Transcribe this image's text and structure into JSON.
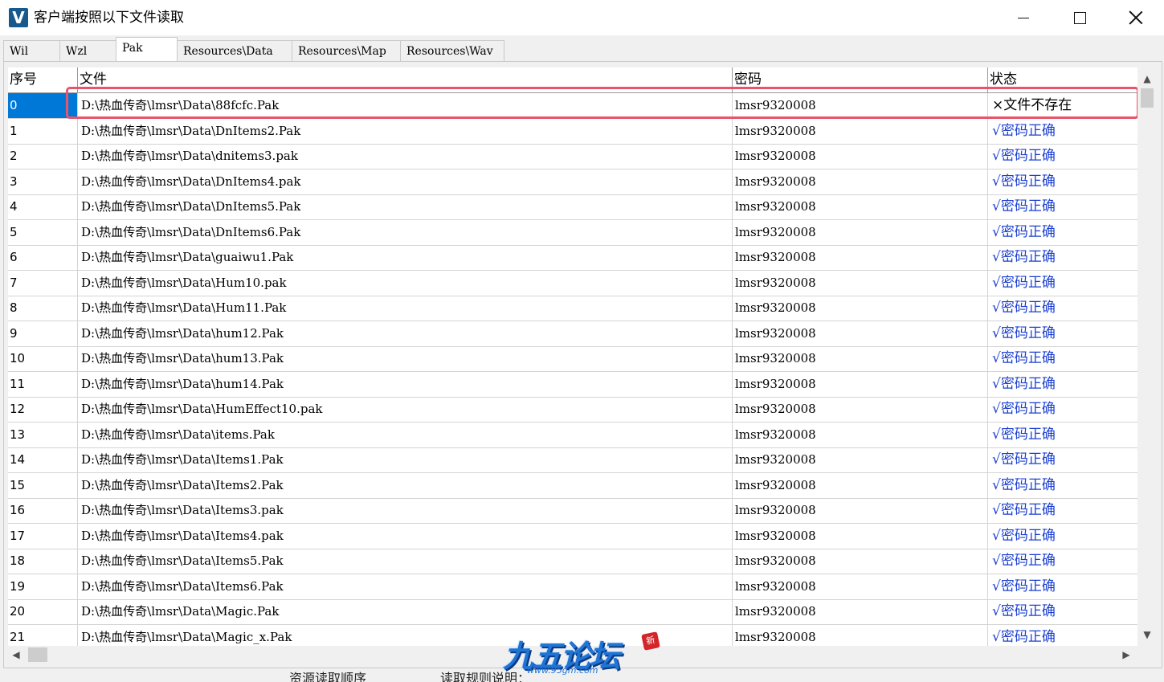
{
  "window": {
    "title": "客户端按照以下文件读取",
    "icon_letter": "V"
  },
  "tabs": [
    {
      "label": "Wil",
      "active": false
    },
    {
      "label": "Wzl",
      "active": false
    },
    {
      "label": "Pak",
      "active": true
    },
    {
      "label": "Resources\\Data",
      "active": false
    },
    {
      "label": "Resources\\Map",
      "active": false
    },
    {
      "label": "Resources\\Wav",
      "active": false
    }
  ],
  "table": {
    "columns": [
      "序号",
      "文件",
      "密码",
      "状态"
    ],
    "rows": [
      {
        "idx": "0",
        "file": "D:\\热血传奇\\lmsr\\Data\\88fcfc.Pak",
        "password": "lmsr9320008",
        "status": "×文件不存在",
        "ok": false
      },
      {
        "idx": "1",
        "file": "D:\\热血传奇\\lmsr\\Data\\DnItems2.Pak",
        "password": "lmsr9320008",
        "status": "√密码正确",
        "ok": true
      },
      {
        "idx": "2",
        "file": "D:\\热血传奇\\lmsr\\Data\\dnitems3.pak",
        "password": "lmsr9320008",
        "status": "√密码正确",
        "ok": true
      },
      {
        "idx": "3",
        "file": "D:\\热血传奇\\lmsr\\Data\\DnItems4.pak",
        "password": "lmsr9320008",
        "status": "√密码正确",
        "ok": true
      },
      {
        "idx": "4",
        "file": "D:\\热血传奇\\lmsr\\Data\\DnItems5.Pak",
        "password": "lmsr9320008",
        "status": "√密码正确",
        "ok": true
      },
      {
        "idx": "5",
        "file": "D:\\热血传奇\\lmsr\\Data\\DnItems6.Pak",
        "password": "lmsr9320008",
        "status": "√密码正确",
        "ok": true
      },
      {
        "idx": "6",
        "file": "D:\\热血传奇\\lmsr\\Data\\guaiwu1.Pak",
        "password": "lmsr9320008",
        "status": "√密码正确",
        "ok": true
      },
      {
        "idx": "7",
        "file": "D:\\热血传奇\\lmsr\\Data\\Hum10.pak",
        "password": "lmsr9320008",
        "status": "√密码正确",
        "ok": true
      },
      {
        "idx": "8",
        "file": "D:\\热血传奇\\lmsr\\Data\\Hum11.Pak",
        "password": "lmsr9320008",
        "status": "√密码正确",
        "ok": true
      },
      {
        "idx": "9",
        "file": "D:\\热血传奇\\lmsr\\Data\\hum12.Pak",
        "password": "lmsr9320008",
        "status": "√密码正确",
        "ok": true
      },
      {
        "idx": "10",
        "file": "D:\\热血传奇\\lmsr\\Data\\hum13.Pak",
        "password": "lmsr9320008",
        "status": "√密码正确",
        "ok": true
      },
      {
        "idx": "11",
        "file": "D:\\热血传奇\\lmsr\\Data\\hum14.Pak",
        "password": "lmsr9320008",
        "status": "√密码正确",
        "ok": true
      },
      {
        "idx": "12",
        "file": "D:\\热血传奇\\lmsr\\Data\\HumEffect10.pak",
        "password": "lmsr9320008",
        "status": "√密码正确",
        "ok": true
      },
      {
        "idx": "13",
        "file": "D:\\热血传奇\\lmsr\\Data\\items.Pak",
        "password": "lmsr9320008",
        "status": "√密码正确",
        "ok": true
      },
      {
        "idx": "14",
        "file": "D:\\热血传奇\\lmsr\\Data\\Items1.Pak",
        "password": "lmsr9320008",
        "status": "√密码正确",
        "ok": true
      },
      {
        "idx": "15",
        "file": "D:\\热血传奇\\lmsr\\Data\\Items2.Pak",
        "password": "lmsr9320008",
        "status": "√密码正确",
        "ok": true
      },
      {
        "idx": "16",
        "file": "D:\\热血传奇\\lmsr\\Data\\Items3.pak",
        "password": "lmsr9320008",
        "status": "√密码正确",
        "ok": true
      },
      {
        "idx": "17",
        "file": "D:\\热血传奇\\lmsr\\Data\\Items4.pak",
        "password": "lmsr9320008",
        "status": "√密码正确",
        "ok": true
      },
      {
        "idx": "18",
        "file": "D:\\热血传奇\\lmsr\\Data\\Items5.Pak",
        "password": "lmsr9320008",
        "status": "√密码正确",
        "ok": true
      },
      {
        "idx": "19",
        "file": "D:\\热血传奇\\lmsr\\Data\\Items6.Pak",
        "password": "lmsr9320008",
        "status": "√密码正确",
        "ok": true
      },
      {
        "idx": "20",
        "file": "D:\\热血传奇\\lmsr\\Data\\Magic.Pak",
        "password": "lmsr9320008",
        "status": "√密码正确",
        "ok": true
      },
      {
        "idx": "21",
        "file": "D:\\热血传奇\\lmsr\\Data\\Magic_x.Pak",
        "password": "lmsr9320008",
        "status": "√密码正确",
        "ok": true
      }
    ]
  },
  "watermark": {
    "text": "九五论坛",
    "url": "www.95gm.com",
    "seal": "新"
  },
  "bottom": {
    "label_1": "资源读取顺序",
    "label_2": "读取规则说明："
  },
  "colors": {
    "ok_status": "#1a3fd0",
    "highlight_border": "#e8546a",
    "selection": "#0078d7"
  }
}
